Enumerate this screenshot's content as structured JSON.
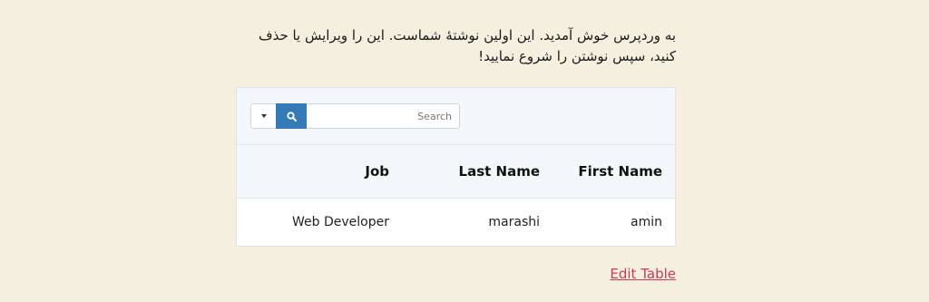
{
  "intro_text": "به وردپرس خوش آمدید. این اولین نوشتهٔ شماست. این را ویرایش یا حذف کنید، سپس نوشتن را شروع نمایید!",
  "toolbar": {
    "dropdown_icon": "caret-down-icon",
    "search_icon": "search-icon",
    "search_placeholder": "Search",
    "search_button_color": "#337ab7"
  },
  "table": {
    "headers": [
      "First Name",
      "Last Name",
      "Job"
    ],
    "rows": [
      [
        "amin",
        "marashi",
        "Web Developer"
      ]
    ]
  },
  "edit_link": "Edit Table",
  "colors": {
    "background": "#f5efe0",
    "link": "#c93a5b"
  }
}
